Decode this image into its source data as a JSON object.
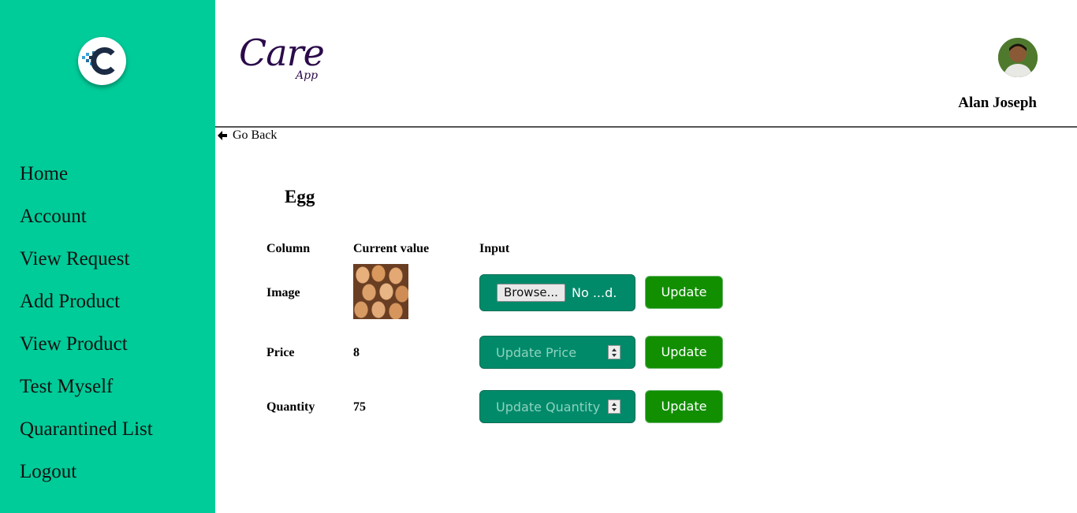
{
  "app": {
    "logo_letter": "C",
    "brand_main": "Care",
    "brand_sub": "App"
  },
  "sidebar": {
    "items": [
      {
        "label": "Home"
      },
      {
        "label": "Account"
      },
      {
        "label": "View Request"
      },
      {
        "label": "Add Product"
      },
      {
        "label": "View Product"
      },
      {
        "label": "Test Myself"
      },
      {
        "label": "Quarantined List"
      },
      {
        "label": "Logout"
      }
    ]
  },
  "header": {
    "user_name": "Alan Joseph"
  },
  "nav": {
    "go_back": "Go Back"
  },
  "product": {
    "title": "Egg",
    "columns": [
      "Column",
      "Current value",
      "Input"
    ],
    "rows": {
      "image": {
        "label": "Image",
        "browse_label": "Browse...",
        "file_name": "No ...d.",
        "update_label": "Update"
      },
      "price": {
        "label": "Price",
        "value": "8",
        "placeholder": "Update Price",
        "update_label": "Update"
      },
      "quantity": {
        "label": "Quantity",
        "value": "75",
        "placeholder": "Update Quantity",
        "update_label": "Update"
      }
    }
  },
  "colors": {
    "sidebar_bg": "#00cc99",
    "input_bg": "#008a6a",
    "update_button_bg": "#118f00"
  },
  "icons": {
    "logo": "care-logo-icon",
    "back": "arrow-left-icon",
    "avatar": "user-avatar"
  }
}
